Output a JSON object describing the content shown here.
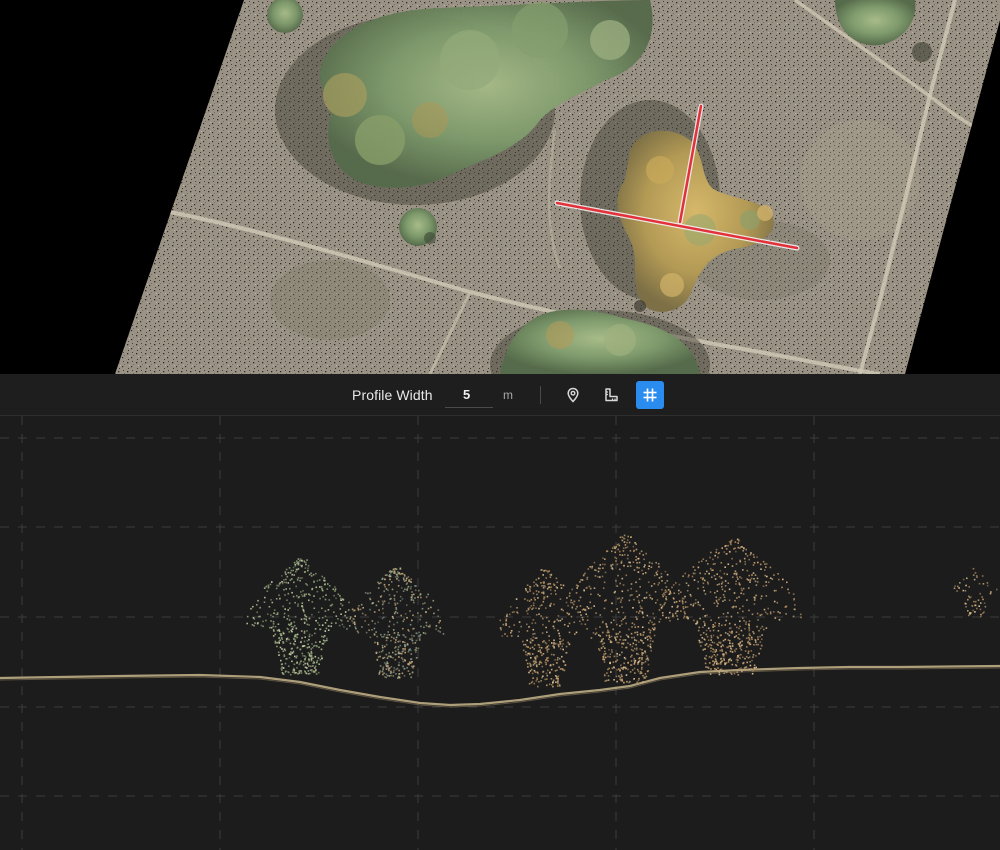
{
  "toolbar": {
    "profile_width_label": "Profile Width",
    "profile_width_value": "5",
    "profile_width_unit": "m",
    "buttons": [
      {
        "name": "location-pin-icon",
        "active": false
      },
      {
        "name": "measure-icon",
        "active": false
      },
      {
        "name": "grid-icon",
        "active": true
      }
    ]
  },
  "colors": {
    "accent": "#2b8cf0",
    "toolbar_bg": "#1e1e1e",
    "profile_bg": "#1c1c1c",
    "profile_line": "#e2313a",
    "grid_line": "#3c3c3c"
  }
}
